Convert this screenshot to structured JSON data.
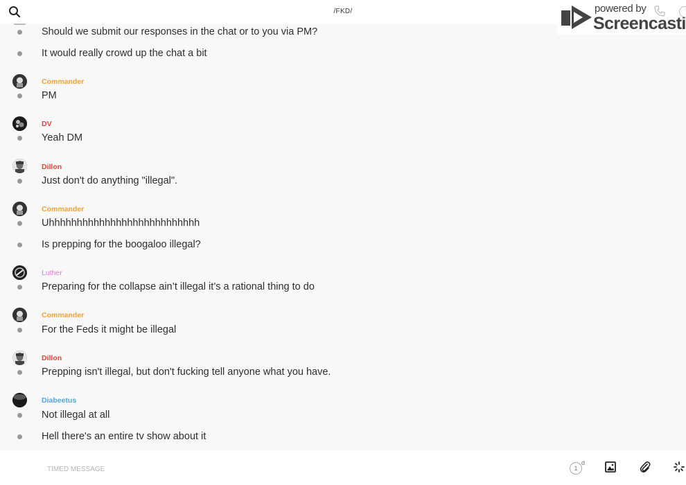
{
  "header": {
    "title": "/FKD/",
    "search_icon": "search-icon"
  },
  "watermark": {
    "powered": "powered by",
    "brand": "Screencastify"
  },
  "messages": [
    {
      "text": "Should we submit our responses in the chat or to you via PM?"
    },
    {
      "text": "It would really crowd up the chat a bit"
    },
    {
      "sender": "Commander",
      "color": "#f0a13a",
      "text": "PM"
    },
    {
      "sender": "DV",
      "color": "#e0453c",
      "text": "Yeah DM"
    },
    {
      "sender": "Dillon",
      "color": "#e0453c",
      "text": "Just don't do anything \"illegal\"."
    },
    {
      "sender": "Commander",
      "color": "#f0a13a",
      "text": "Uhhhhhhhhhhhhhhhhhhhhhhhhhhh"
    },
    {
      "text": "Is prepping for the boogaloo illegal?"
    },
    {
      "sender": "Luther",
      "color": "#e27ad0",
      "text": "Preparing for the collapse ain’t illegal it’s a rational thing to do"
    },
    {
      "sender": "Commander",
      "color": "#f0a13a",
      "text": "For the Feds it might be illegal"
    },
    {
      "sender": "Dillon",
      "color": "#e0453c",
      "text": "Prepping isn't illegal, but don't fucking tell anyone what you have."
    },
    {
      "sender": "Diabeetus",
      "color": "#4ea8d8",
      "text": "Not illegal at all"
    },
    {
      "text": "Hell there's an entire tv show about it"
    }
  ],
  "composer": {
    "placeholder": "TIMED MESSAGE",
    "timer_value": "1",
    "timer_unit": "d"
  },
  "icons": {
    "image": "image-icon",
    "attach": "paperclip-icon",
    "loading": "spinner-icon",
    "phone": "phone-icon",
    "info": "info-icon"
  }
}
